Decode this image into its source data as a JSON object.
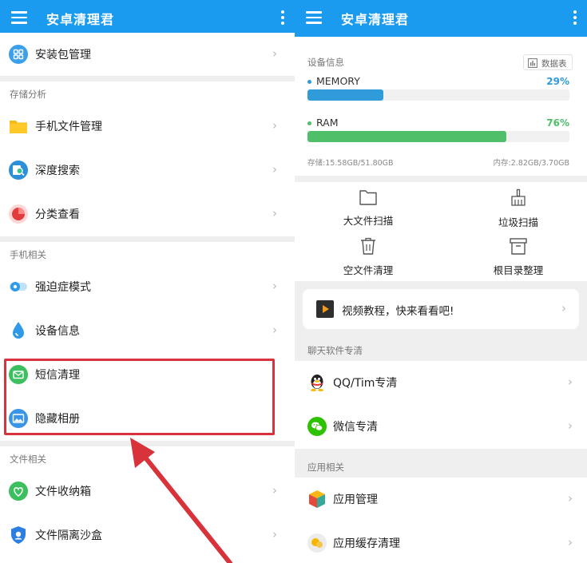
{
  "left": {
    "appbar": {
      "title": "安卓清理君"
    },
    "items": {
      "apk": "安装包管理",
      "storage_section": "存储分析",
      "file_mgr": "手机文件管理",
      "deep_search": "深度搜索",
      "category": "分类查看",
      "phone_section": "手机相关",
      "ocd": "强迫症模式",
      "device_info": "设备信息",
      "sms": "短信清理",
      "hidden_album": "隐藏相册",
      "file_section": "文件相关",
      "file_box": "文件收纳箱",
      "sandbox": "文件隔离沙盒"
    }
  },
  "right": {
    "appbar": {
      "title": "安卓清理君"
    },
    "device": {
      "title": "设备信息",
      "table_button": "数据表",
      "memory_label": "MEMORY",
      "memory_pct": "29%",
      "memory_value": 0.29,
      "ram_label": "RAM",
      "ram_pct": "76%",
      "ram_value": 0.76,
      "storage_text": "存储:15.58GB/51.80GB",
      "ram_text": "内存:2.82GB/3.70GB"
    },
    "tools": {
      "big_file": "大文件扫描",
      "junk": "垃圾扫描",
      "empty_file": "空文件清理",
      "root_dir": "根目录整理"
    },
    "tutorial": "视频教程，快来看看吧!",
    "chat_section": "聊天软件专清",
    "qq": "QQ/Tim专清",
    "wechat": "微信专清",
    "app_section": "应用相关",
    "app_mgr": "应用管理",
    "app_cache": "应用缓存清理"
  },
  "colors": {
    "accent": "#1a9bf0",
    "memory": "#2f9bd9",
    "ram": "#4fbf6a",
    "highlight": "#d8333b"
  }
}
